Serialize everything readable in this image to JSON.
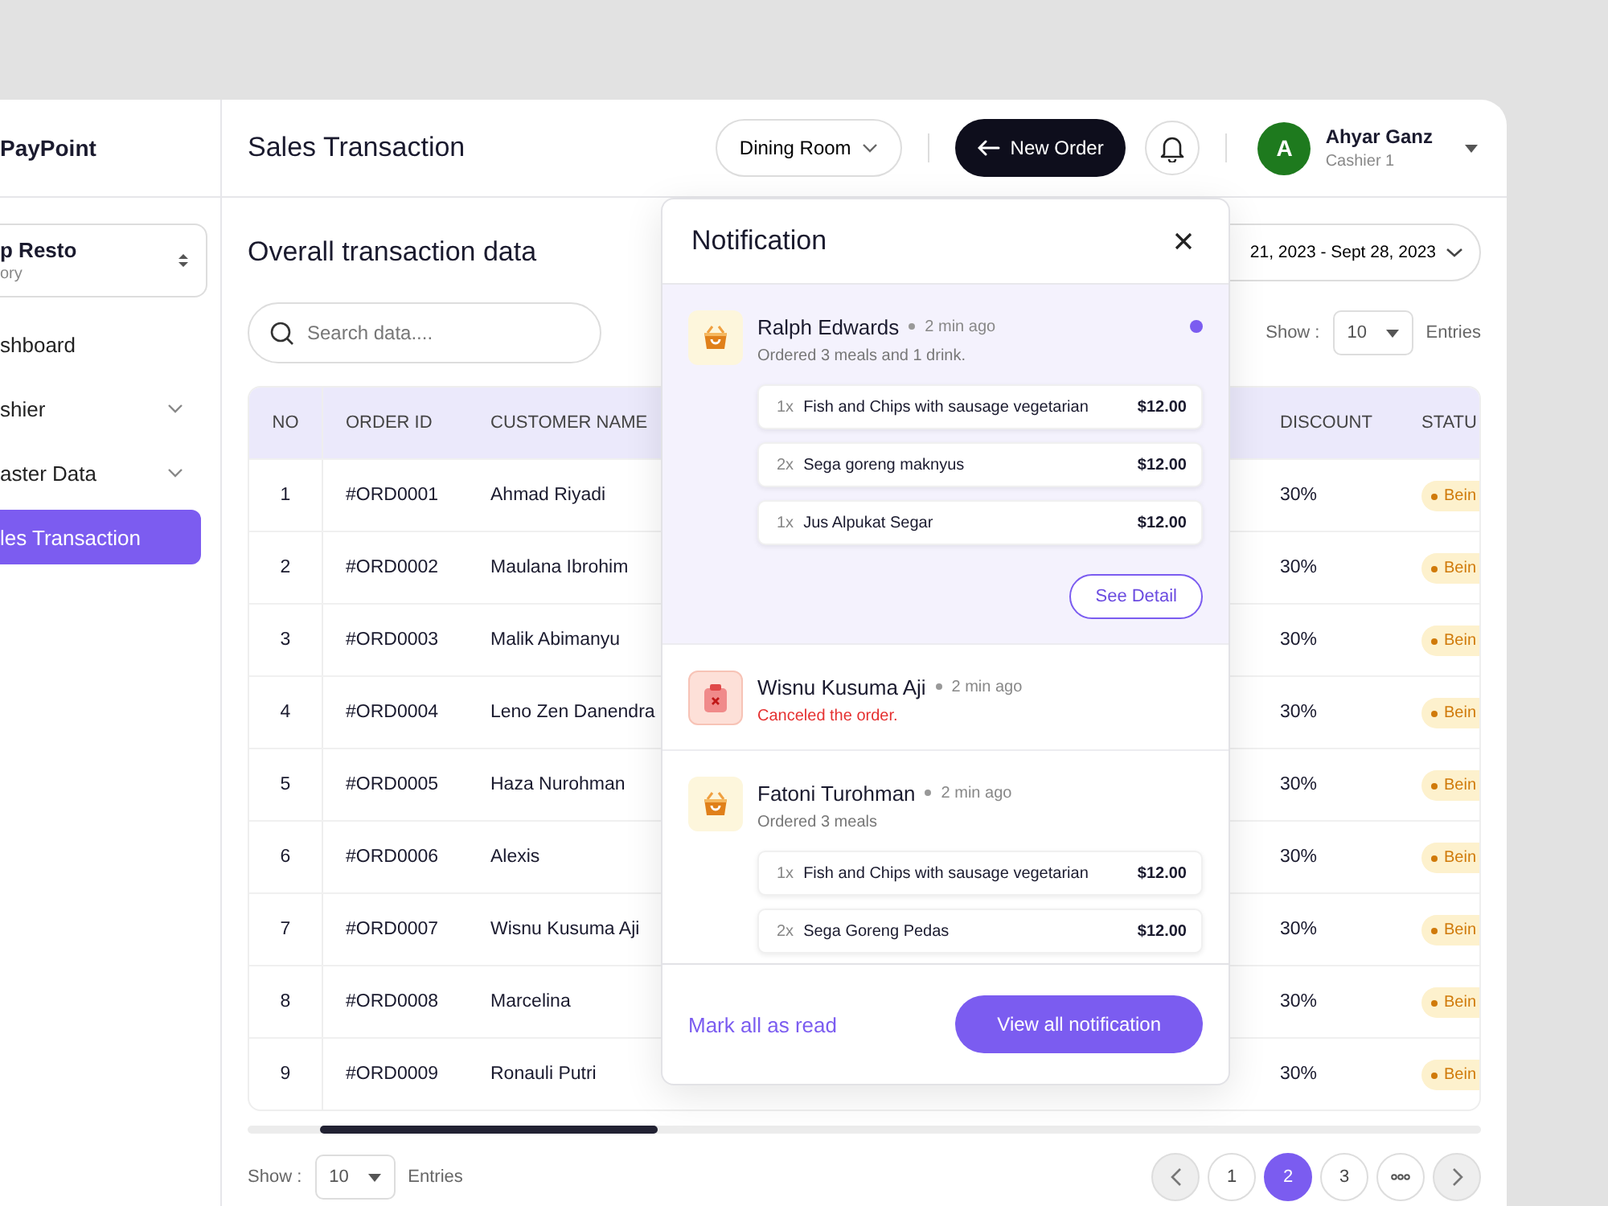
{
  "sidebar": {
    "brand": "PayPoint",
    "outlet": {
      "name": "p Resto",
      "subtitle": "ory"
    },
    "items": [
      {
        "label": "shboard",
        "expandable": false,
        "selected": false
      },
      {
        "label": "shier",
        "expandable": true,
        "selected": false
      },
      {
        "label": "aster Data",
        "expandable": true,
        "selected": false
      },
      {
        "label": "les Transaction",
        "expandable": false,
        "selected": true
      }
    ]
  },
  "topbar": {
    "title": "Sales Transaction",
    "room_select": "Dining Room",
    "new_order": "New Order",
    "user": {
      "initial": "A",
      "name": "Ahyar Ganz",
      "role": "Cashier 1"
    }
  },
  "content": {
    "heading": "Overall transaction data",
    "date_range": "21, 2023 - Sept 28, 2023",
    "search": {
      "placeholder": "Search data...."
    },
    "page_size": {
      "label": "Show :",
      "value": "10",
      "suffix": "Entries"
    }
  },
  "table": {
    "columns": [
      "NO",
      "ORDER ID",
      "CUSTOMER NAME",
      "DISCOUNT",
      "STATU"
    ],
    "rows": [
      {
        "no": "1",
        "order_id": "#ORD0001",
        "customer": "Ahmad Riyadi",
        "discount": "30%",
        "status": "Bein"
      },
      {
        "no": "2",
        "order_id": "#ORD0002",
        "customer": "Maulana Ibrohim",
        "discount": "30%",
        "status": "Bein"
      },
      {
        "no": "3",
        "order_id": "#ORD0003",
        "customer": "Malik Abimanyu",
        "discount": "30%",
        "status": "Bein"
      },
      {
        "no": "4",
        "order_id": "#ORD0004",
        "customer": "Leno Zen Danendra",
        "discount": "30%",
        "status": "Bein"
      },
      {
        "no": "5",
        "order_id": "#ORD0005",
        "customer": "Haza Nurohman",
        "discount": "30%",
        "status": "Bein"
      },
      {
        "no": "6",
        "order_id": "#ORD0006",
        "customer": "Alexis",
        "discount": "30%",
        "status": "Bein"
      },
      {
        "no": "7",
        "order_id": "#ORD0007",
        "customer": "Wisnu Kusuma Aji",
        "discount": "30%",
        "status": "Bein"
      },
      {
        "no": "8",
        "order_id": "#ORD0008",
        "customer": "Marcelina",
        "discount": "30%",
        "status": "Bein"
      },
      {
        "no": "9",
        "order_id": "#ORD0009",
        "customer": "Ronauli Putri",
        "discount": "30%",
        "status": "Bein"
      }
    ]
  },
  "footer": {
    "page_size": {
      "label": "Show :",
      "value": "10",
      "suffix": "Entries"
    },
    "pages": [
      {
        "label": "1",
        "selected": false
      },
      {
        "label": "2",
        "selected": true
      },
      {
        "label": "3",
        "selected": false
      }
    ]
  },
  "notifications": {
    "title": "Notification",
    "items": [
      {
        "kind": "order",
        "unread": true,
        "name": "Ralph Edwards",
        "time": "2 min ago",
        "message": "Ordered 3 meals and 1 drink.",
        "order_items": [
          {
            "qty": "1x",
            "name": "Fish and Chips with sausage vegetarian",
            "price": "$12.00"
          },
          {
            "qty": "2x",
            "name": "Sega goreng maknyus",
            "price": "$12.00"
          },
          {
            "qty": "1x",
            "name": "Jus Alpukat Segar",
            "price": "$12.00"
          }
        ],
        "action": "See Detail"
      },
      {
        "kind": "cancel",
        "unread": false,
        "name": "Wisnu Kusuma Aji",
        "time": "2 min ago",
        "message": "Canceled the order."
      },
      {
        "kind": "order",
        "unread": false,
        "name": "Fatoni Turohman",
        "time": "2 min ago",
        "message": "Ordered 3 meals",
        "order_items": [
          {
            "qty": "1x",
            "name": "Fish and Chips with sausage vegetarian",
            "price": "$12.00"
          },
          {
            "qty": "2x",
            "name": "Sega Goreng Pedas",
            "price": "$12.00"
          }
        ]
      }
    ],
    "mark_all": "Mark all as read",
    "view_all": "View all notification"
  }
}
